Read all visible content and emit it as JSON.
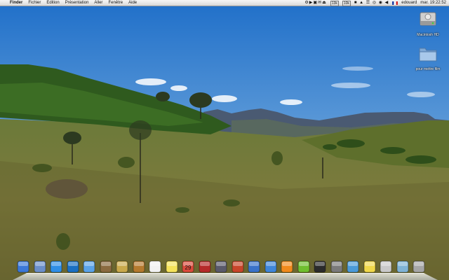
{
  "menubar": {
    "apple_glyph": "",
    "app_name": "Finder",
    "menus": [
      "Fichier",
      "Edition",
      "Présentation",
      "Aller",
      "Fenêtre",
      "Aide"
    ],
    "status": {
      "item1": "13k",
      "item2": "10k",
      "user": "edouard",
      "clock": "mar. 19:22:52"
    }
  },
  "desktop": {
    "icons": [
      {
        "label": "Macintosh HD",
        "icon": "hard-drive-icon"
      },
      {
        "label": "pour mettre film",
        "icon": "folder-icon"
      }
    ]
  },
  "dock": {
    "items": [
      {
        "name": "finder",
        "color": "#3b78d8"
      },
      {
        "name": "preview",
        "color": "#6b8fc9"
      },
      {
        "name": "safari",
        "color": "#2f8ee6"
      },
      {
        "name": "system-prefs",
        "color": "#1a6fc2"
      },
      {
        "name": "itunes",
        "color": "#5aa3e8"
      },
      {
        "name": "iphoto",
        "color": "#8a6a40"
      },
      {
        "name": "stickies-app",
        "color": "#c9a94b"
      },
      {
        "name": "guitar",
        "color": "#b57a2e"
      },
      {
        "name": "textedit",
        "color": "#f2f2f2"
      },
      {
        "name": "stickies",
        "color": "#f5e35a"
      },
      {
        "name": "ical",
        "color": "#d94a3b",
        "text": "29"
      },
      {
        "name": "address-book",
        "color": "#b52a2a"
      },
      {
        "name": "script-editor",
        "color": "#5a5a6a"
      },
      {
        "name": "photo-booth",
        "color": "#c8452a"
      },
      {
        "name": "widget",
        "color": "#3a72c8"
      },
      {
        "name": "user",
        "color": "#3f86d9"
      },
      {
        "name": "vlc",
        "color": "#f08a1c"
      },
      {
        "name": "green-app",
        "color": "#6fbf2f"
      },
      {
        "name": "stop",
        "color": "#2b2b2b"
      },
      {
        "name": "chess",
        "color": "#7a7a7a"
      },
      {
        "name": "network",
        "color": "#4a9ad8"
      },
      {
        "name": "stickies-2",
        "color": "#f0d84a"
      },
      {
        "name": "archive",
        "color": "#c9c9c9"
      },
      {
        "name": "downloads",
        "color": "#7fb3d5"
      },
      {
        "name": "trash",
        "color": "#a6a6a6"
      }
    ]
  }
}
